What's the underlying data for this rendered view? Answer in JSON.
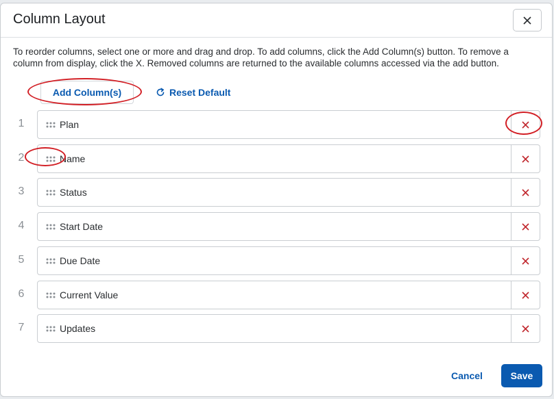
{
  "dialog": {
    "title": "Column Layout",
    "instructions": "To reorder columns, select one or more and drag and drop. To add columns, click the Add Column(s) button. To remove a column from display, click the X. Removed columns are returned to the available columns accessed via the add button."
  },
  "toolbar": {
    "add_label": "Add Column(s)",
    "reset_label": "Reset Default"
  },
  "columns": [
    {
      "index": "1",
      "label": "Plan"
    },
    {
      "index": "2",
      "label": "Name"
    },
    {
      "index": "3",
      "label": "Status"
    },
    {
      "index": "4",
      "label": "Start Date"
    },
    {
      "index": "5",
      "label": "Due Date"
    },
    {
      "index": "6",
      "label": "Current Value"
    },
    {
      "index": "7",
      "label": "Updates"
    }
  ],
  "footer": {
    "cancel_label": "Cancel",
    "save_label": "Save"
  },
  "colors": {
    "accent": "#0a5ab0",
    "remove": "#c0262c",
    "annotation": "#d21f25"
  },
  "icons": {
    "close": "close-icon",
    "reset": "refresh-icon",
    "drag": "drag-handle-icon",
    "remove": "remove-x-icon"
  }
}
